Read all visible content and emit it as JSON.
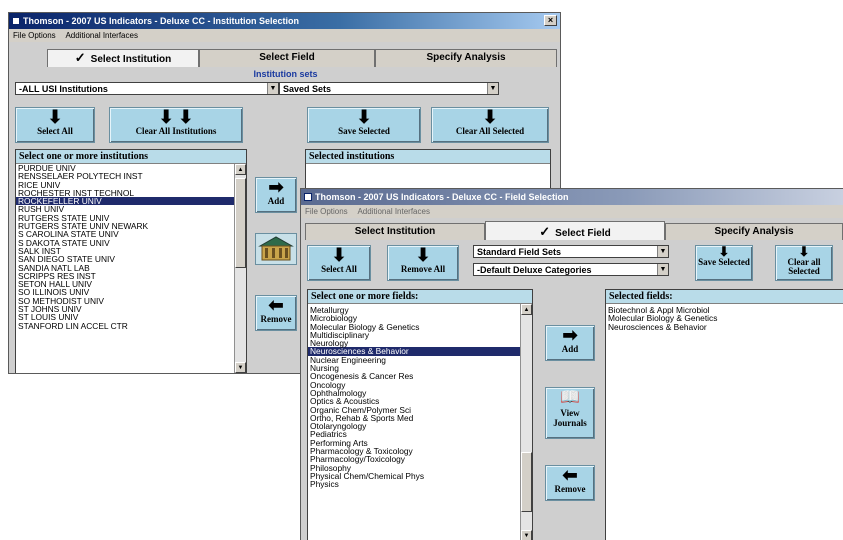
{
  "win1": {
    "title": "Thomson - 2007 US Indicators - Deluxe CC - Institution Selection",
    "close": "×",
    "menu": [
      "File Options",
      "Additional Interfaces"
    ],
    "tabs": [
      "Select Institution",
      "Select Field",
      "Specify Analysis"
    ],
    "check": "✓",
    "section_label": "Institution sets",
    "combo_inst": "-ALL USI Institutions",
    "combo_saved": "Saved Sets",
    "buttons": {
      "select_all": "Select All",
      "clear_all": "Clear All Institutions",
      "save_selected": "Save Selected",
      "clear_all_selected": "Clear All Selected",
      "add": "Add",
      "remove": "Remove"
    },
    "list_head": "Select one or more institutions",
    "selected_head": "Selected institutions",
    "list": [
      "PURDUE UNIV",
      "RENSSELAER POLYTECH INST",
      "RICE UNIV",
      "ROCHESTER INST TECHNOL",
      "ROCKEFELLER UNIV",
      "RUSH UNIV",
      "RUTGERS STATE UNIV",
      "RUTGERS STATE UNIV NEWARK",
      "S CAROLINA STATE UNIV",
      "S DAKOTA STATE UNIV",
      "SALK INST",
      "SAN DIEGO STATE UNIV",
      "SANDIA NATL LAB",
      "SCRIPPS RES INST",
      "SETON HALL UNIV",
      "SO ILLINOIS UNIV",
      "SO METHODIST UNIV",
      "ST JOHNS UNIV",
      "ST LOUIS UNIV",
      "STANFORD LIN ACCEL CTR"
    ],
    "selected_index": 4
  },
  "win2": {
    "title": "Thomson - 2007 US Indicators - Deluxe CC - Field Selection",
    "menu": [
      "File Options",
      "Additional Interfaces"
    ],
    "tabs": [
      "Select Institution",
      "Select Field",
      "Specify Analysis"
    ],
    "check": "✓",
    "combo_sets": "Standard Field Sets",
    "combo_cats": "-Default Deluxe Categories",
    "buttons": {
      "select_all": "Select All",
      "remove_all": "Remove All",
      "save_selected": "Save Selected",
      "clear_all_selected": "Clear all Selected",
      "add": "Add",
      "view_journals": "View Journals",
      "remove": "Remove"
    },
    "list_head": "Select one or more fields:",
    "selected_head": "Selected fields:",
    "list": [
      "Metallurgy",
      "Microbiology",
      "Molecular Biology & Genetics",
      "Multidisciplinary",
      "Neurology",
      "Neurosciences & Behavior",
      "Nuclear Engineering",
      "Nursing",
      "Oncogenesis & Cancer Res",
      "Oncology",
      "Ophthalmology",
      "Optics & Acoustics",
      "Organic Chem/Polymer Sci",
      "Ortho, Rehab & Sports Med",
      "Otolaryngology",
      "Pediatrics",
      "Performing Arts",
      "Pharmacology & Toxicology",
      "Pharmacology/Toxicology",
      "Philosophy",
      "Physical Chem/Chemical Phys",
      "Physics"
    ],
    "selected_index": 5,
    "selected_fields": [
      "Biotechnol & Appl Microbiol",
      "Molecular Biology & Genetics",
      "Neurosciences & Behavior"
    ]
  }
}
